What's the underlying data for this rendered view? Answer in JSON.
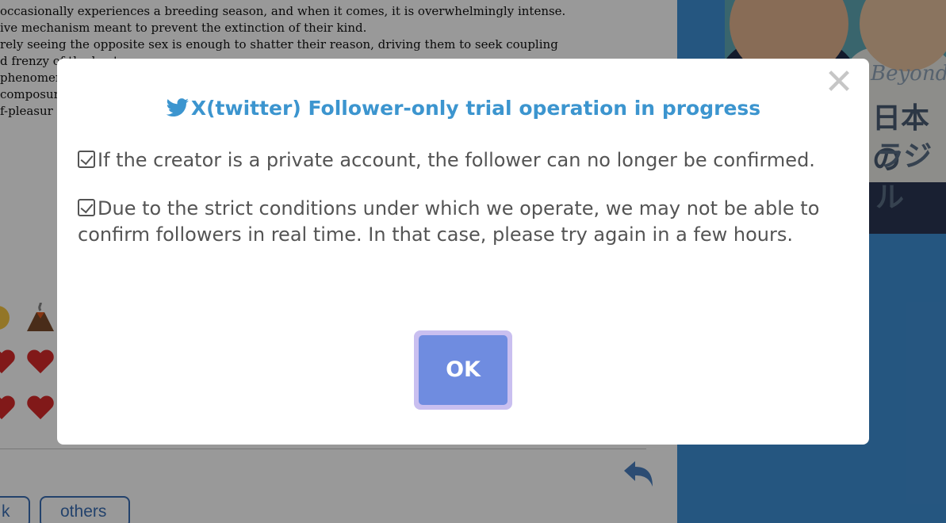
{
  "background": {
    "story_lines": [
      "occasionally experiences a breeding season, and when it comes, it is overwhelmingly intense.",
      "ive mechanism meant to prevent the extinction of their kind.",
      "rely seeing the opposite sex is enough to shatter their reason, driving them to seek coupling",
      "d frenzy of the heat.",
      " phenomen",
      "composure",
      "f-pleasur"
    ],
    "tags": [
      "k",
      "others"
    ],
    "banner": {
      "script_text": "Beyond",
      "jp_line1": "日本の",
      "jp_line2": "ラジル"
    }
  },
  "modal": {
    "close_glyph": "✕",
    "title": "X(twitter) Follower-only trial operation in progress",
    "notices": [
      "If the creator is a private account, the follower can no longer be confirmed.",
      "Due to the strict conditions under which we operate, we may not be able to confirm followers in real time. In that case, please try again in a few hours."
    ],
    "ok_label": "OK"
  },
  "colors": {
    "title": "#3c95cf",
    "ok_button": "#6f8ce0",
    "ok_ring": "#c9bff0",
    "overlay": "rgba(0,0,0,0.40)"
  }
}
